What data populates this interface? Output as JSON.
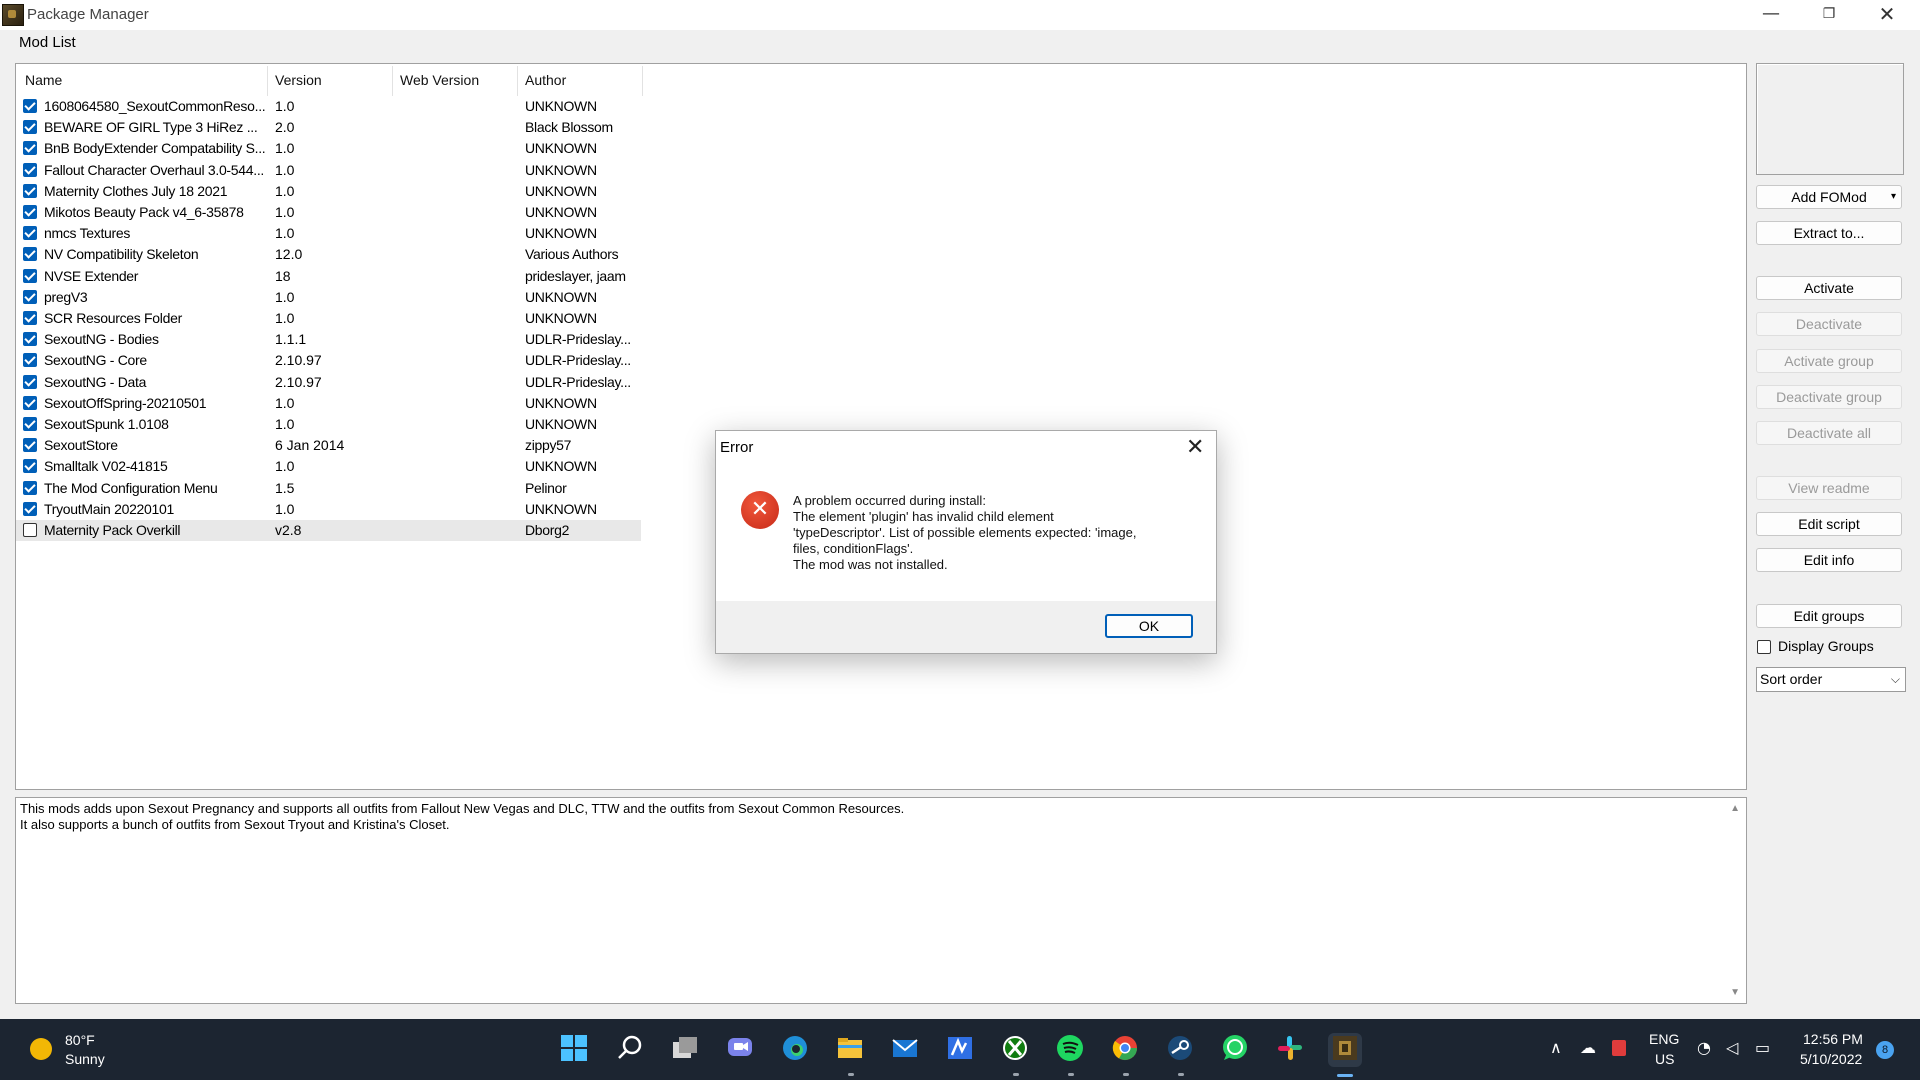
{
  "window": {
    "title": "Package Manager",
    "min_glyph": "—",
    "max_glyph": "❐",
    "close_glyph": "✕"
  },
  "menu": {
    "mod_list": "Mod List"
  },
  "columns": {
    "name": "Name",
    "version": "Version",
    "web_version": "Web Version",
    "author": "Author"
  },
  "mods": [
    {
      "checked": true,
      "name": "1608064580_SexoutCommonReso...",
      "version": "1.0",
      "web_version": "",
      "author": "UNKNOWN"
    },
    {
      "checked": true,
      "name": "BEWARE OF GIRL Type 3 HiRez ...",
      "version": "2.0",
      "web_version": "",
      "author": "Black Blossom"
    },
    {
      "checked": true,
      "name": "BnB BodyExtender Compatability S...",
      "version": "1.0",
      "web_version": "",
      "author": "UNKNOWN"
    },
    {
      "checked": true,
      "name": "Fallout Character Overhaul 3.0-544...",
      "version": "1.0",
      "web_version": "",
      "author": "UNKNOWN"
    },
    {
      "checked": true,
      "name": "Maternity Clothes July 18 2021",
      "version": "1.0",
      "web_version": "",
      "author": "UNKNOWN"
    },
    {
      "checked": true,
      "name": "Mikotos Beauty Pack v4_6-35878",
      "version": "1.0",
      "web_version": "",
      "author": "UNKNOWN"
    },
    {
      "checked": true,
      "name": "nmcs Textures",
      "version": "1.0",
      "web_version": "",
      "author": "UNKNOWN"
    },
    {
      "checked": true,
      "name": "NV Compatibility Skeleton",
      "version": "12.0",
      "web_version": "",
      "author": "Various Authors"
    },
    {
      "checked": true,
      "name": "NVSE Extender",
      "version": "18",
      "web_version": "",
      "author": "prideslayer, jaam"
    },
    {
      "checked": true,
      "name": "pregV3",
      "version": "1.0",
      "web_version": "",
      "author": "UNKNOWN"
    },
    {
      "checked": true,
      "name": "SCR Resources Folder",
      "version": "1.0",
      "web_version": "",
      "author": "UNKNOWN"
    },
    {
      "checked": true,
      "name": "SexoutNG - Bodies",
      "version": "1.1.1",
      "web_version": "",
      "author": "UDLR-Prideslay..."
    },
    {
      "checked": true,
      "name": "SexoutNG - Core",
      "version": "2.10.97",
      "web_version": "",
      "author": "UDLR-Prideslay..."
    },
    {
      "checked": true,
      "name": "SexoutNG - Data",
      "version": "2.10.97",
      "web_version": "",
      "author": "UDLR-Prideslay..."
    },
    {
      "checked": true,
      "name": "SexoutOffSpring-20210501",
      "version": "1.0",
      "web_version": "",
      "author": "UNKNOWN"
    },
    {
      "checked": true,
      "name": "SexoutSpunk 1.0108",
      "version": "1.0",
      "web_version": "",
      "author": "UNKNOWN"
    },
    {
      "checked": true,
      "name": "SexoutStore",
      "version": "6 Jan 2014",
      "web_version": "",
      "author": "zippy57"
    },
    {
      "checked": true,
      "name": "Smalltalk V02-41815",
      "version": "1.0",
      "web_version": "",
      "author": "UNKNOWN"
    },
    {
      "checked": true,
      "name": "The Mod Configuration Menu",
      "version": "1.5",
      "web_version": "",
      "author": "Pelinor"
    },
    {
      "checked": true,
      "name": "TryoutMain 20220101",
      "version": "1.0",
      "web_version": "",
      "author": "UNKNOWN"
    },
    {
      "checked": false,
      "name": "Maternity Pack Overkill",
      "version": "v2.8",
      "web_version": "",
      "author": "Dborg2",
      "selected": true
    }
  ],
  "description": {
    "line1": "This mods adds upon Sexout Pregnancy and supports all outfits from Fallout New Vegas and DLC, TTW and the outfits from Sexout Common Resources.",
    "line2": "It also supports a bunch of outfits from Sexout Tryout and Kristina's Closet.",
    "scroll_up": "▲",
    "scroll_down": "▼"
  },
  "side": {
    "add_fomod": "Add FOMod",
    "add_fomod_arrow": "▾",
    "extract": "Extract to...",
    "activate": "Activate",
    "deactivate": "Deactivate",
    "activate_group": "Activate group",
    "deactivate_group": "Deactivate group",
    "deactivate_all": "Deactivate all",
    "view_readme": "View readme",
    "edit_script": "Edit script",
    "edit_info": "Edit info",
    "edit_groups": "Edit groups",
    "display_groups": "Display Groups",
    "sort_order": "Sort order",
    "sort_chevron": "⌵"
  },
  "dialog": {
    "title": "Error",
    "close_glyph": "✕",
    "icon_glyph": "✕",
    "lines": [
      "A problem occurred during install:",
      "The element 'plugin' has invalid child element",
      "'typeDescriptor'. List of possible elements expected: 'image,",
      "files, conditionFlags'.",
      "The mod was not installed."
    ],
    "ok": "OK"
  },
  "taskbar": {
    "weather_temp": "80°F",
    "weather_desc": "Sunny",
    "lang_top": "ENG",
    "lang_bottom": "US",
    "time": "12:56 PM",
    "date": "5/10/2022",
    "badge": "8",
    "apps": [
      "start-icon",
      "search-icon",
      "task-view-icon",
      "teams-chat-icon",
      "edge-icon",
      "file-explorer-icon",
      "mail-icon",
      "editor-icon",
      "xbox-icon",
      "spotify-icon",
      "chrome-icon",
      "steam-icon",
      "whatsapp-icon",
      "slack-icon",
      "package-manager-icon"
    ],
    "tray_glyphs": {
      "chevron": "∧",
      "cloud": "☁",
      "wifi": "◔",
      "volume": "◁",
      "battery": "▭"
    }
  }
}
